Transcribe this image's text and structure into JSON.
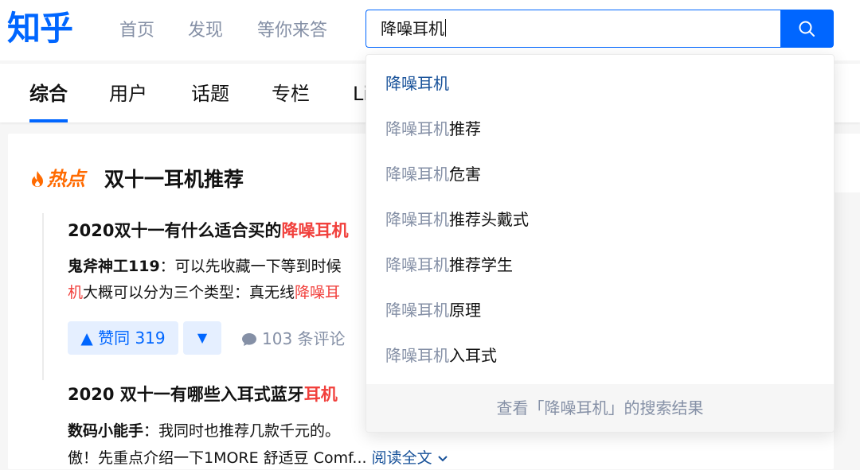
{
  "header": {
    "logo": "知乎",
    "nav": {
      "home": "首页",
      "explore": "发现",
      "waiting": "等你来答"
    },
    "search": {
      "value": "降噪耳机"
    }
  },
  "tabs": {
    "all": "综合",
    "users": "用户",
    "topics": "话题",
    "columns": "专栏",
    "live": "Li"
  },
  "hot": {
    "badge": "热点",
    "title": "双十一耳机推荐"
  },
  "items": [
    {
      "title_pre": "2020双十一有什么适合买的",
      "title_hl": "降噪耳机",
      "author": "鬼斧神工119",
      "excerpt_a": "：可以先收藏一下等到时候",
      "excerpt_b_hl": "机",
      "excerpt_b": "大概可以分为三个类型：真无线",
      "excerpt_b_hl2": "降噪耳"
    },
    {
      "title_pre": "2020 双十一有哪些入耳式蓝牙",
      "title_hl": "耳机",
      "author": "数码小能手",
      "excerpt_a": "：我同时也推荐几款千元的。",
      "excerpt_b": "傲！先重点介绍一下1MORE 舒适豆 Comf...",
      "read_more": "阅读全文"
    }
  ],
  "actions": {
    "vote_up": "▲ 赞同 319",
    "vote_down": "▼",
    "comments": "103 条评论"
  },
  "suggestions": {
    "prefix": "降噪耳机",
    "items": [
      {
        "suffix": ""
      },
      {
        "suffix": "推荐"
      },
      {
        "suffix": "危害"
      },
      {
        "suffix": "推荐头戴式"
      },
      {
        "suffix": "推荐学生"
      },
      {
        "suffix": "原理"
      },
      {
        "suffix": "入耳式"
      }
    ],
    "footer": "查看「降噪耳机」的搜索结果"
  },
  "colors": {
    "brand": "#0066ff",
    "highlight": "#f1403c",
    "hot": "#ff6a00",
    "muted": "#8590a6"
  }
}
